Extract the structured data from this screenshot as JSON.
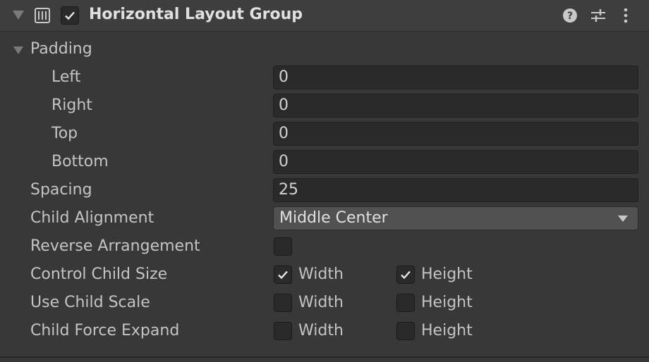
{
  "header": {
    "title": "Horizontal Layout Group",
    "enabled": true,
    "icons": [
      "foldout-arrow-icon",
      "layout-group-icon",
      "help-icon",
      "presets-icon",
      "more-options-icon"
    ]
  },
  "padding": {
    "label": "Padding",
    "left_label": "Left",
    "left_value": "0",
    "right_label": "Right",
    "right_value": "0",
    "top_label": "Top",
    "top_value": "0",
    "bottom_label": "Bottom",
    "bottom_value": "0"
  },
  "spacing": {
    "label": "Spacing",
    "value": "25"
  },
  "child_alignment": {
    "label": "Child Alignment",
    "value": "Middle Center"
  },
  "reverse_arrangement": {
    "label": "Reverse Arrangement",
    "checked": false
  },
  "control_child_size": {
    "label": "Control Child Size",
    "width_label": "Width",
    "width_checked": true,
    "height_label": "Height",
    "height_checked": true
  },
  "use_child_scale": {
    "label": "Use Child Scale",
    "width_label": "Width",
    "width_checked": false,
    "height_label": "Height",
    "height_checked": false
  },
  "child_force_expand": {
    "label": "Child Force Expand",
    "width_label": "Width",
    "width_checked": false,
    "height_label": "Height",
    "height_checked": false
  },
  "colors": {
    "background": "#383838",
    "header": "#3e3e3e",
    "field": "#2a2a2a",
    "dropdown": "#515151",
    "text": "#c4c4c4"
  }
}
